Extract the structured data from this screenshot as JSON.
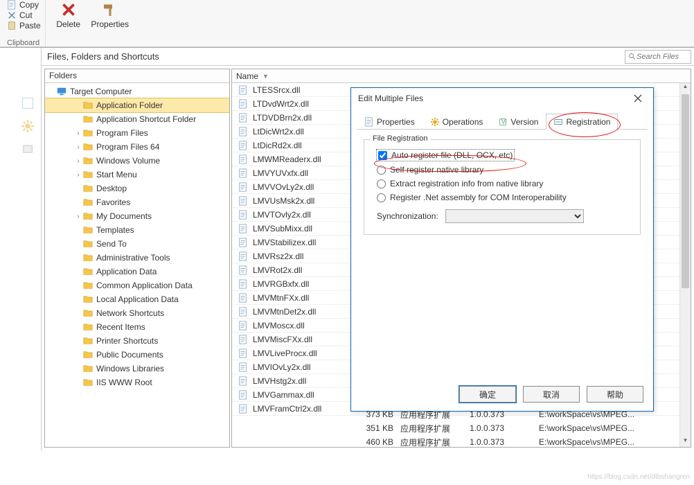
{
  "ribbon": {
    "copy": "Copy",
    "cut": "Cut",
    "paste": "Paste",
    "delete": "Delete",
    "properties": "Properties",
    "clipboard_label": "Clipboard"
  },
  "section_title": "Files, Folders and Shortcuts",
  "search": {
    "placeholder": "Search Files"
  },
  "folders_hdr": "Folders",
  "tree": {
    "root": "Target Computer",
    "items": [
      "Application Folder",
      "Application Shortcut Folder",
      "Program Files",
      "Program Files 64",
      "Windows Volume",
      "Start Menu",
      "Desktop",
      "Favorites",
      "My Documents",
      "Templates",
      "Send To",
      "Administrative Tools",
      "Application Data",
      "Common Application Data",
      "Local Application Data",
      "Network Shortcuts",
      "Recent Items",
      "Printer Shortcuts",
      "Public Documents",
      "Windows Libraries",
      "IIS WWW Root"
    ]
  },
  "files_hdr": "Name",
  "files": [
    "LTESSrcx.dll",
    "LTDvdWrt2x.dll",
    "LTDVDBrn2x.dll",
    "LtDicWrt2x.dll",
    "LtDicRd2x.dll",
    "LMWMReaderx.dll",
    "LMVYUVxfx.dll",
    "LMVVOvLy2x.dll",
    "LMVUsMsk2x.dll",
    "LMVTOvly2x.dll",
    "LMVSubMixx.dll",
    "LMVStabilizex.dll",
    "LMVRsz2x.dll",
    "LMVRot2x.dll",
    "LMVRGBxfx.dll",
    "LMVMtnFXx.dll",
    "LMVMtnDet2x.dll",
    "LMVMoscx.dll",
    "LMVMiscFXx.dll",
    "LMVLiveProcx.dll",
    "LMVIOvLy2x.dll",
    "LMVHstg2x.dll",
    "LMVGammax.dll",
    "LMVFramCtrl2x.dll"
  ],
  "details": [
    {
      "size": "373 KB",
      "type": "应用程序扩展",
      "ver": "1.0.0.373",
      "path": "E:\\workSpace\\vs\\MPEG..."
    },
    {
      "size": "351 KB",
      "type": "应用程序扩展",
      "ver": "1.0.0.373",
      "path": "E:\\workSpace\\vs\\MPEG..."
    },
    {
      "size": "460 KB",
      "type": "应用程序扩展",
      "ver": "1.0.0.373",
      "path": "E:\\workSpace\\vs\\MPEG..."
    }
  ],
  "dialog": {
    "title": "Edit Multiple Files",
    "tabs": {
      "properties": "Properties",
      "operations": "Operations",
      "version": "Version",
      "registration": "Registration"
    },
    "legend": "File Registration",
    "opt_auto": "Auto register file (DLL, OCX, etc)",
    "opt_self": "Self register native library",
    "opt_extract": "Extract registration info from native library",
    "opt_net": "Register .Net assembly for COM Interoperability",
    "sync_label": "Synchronization:",
    "ok": "确定",
    "cancel": "取消",
    "help": "帮助"
  },
  "watermark": "https://blog.csdn.net/dtbshangren"
}
